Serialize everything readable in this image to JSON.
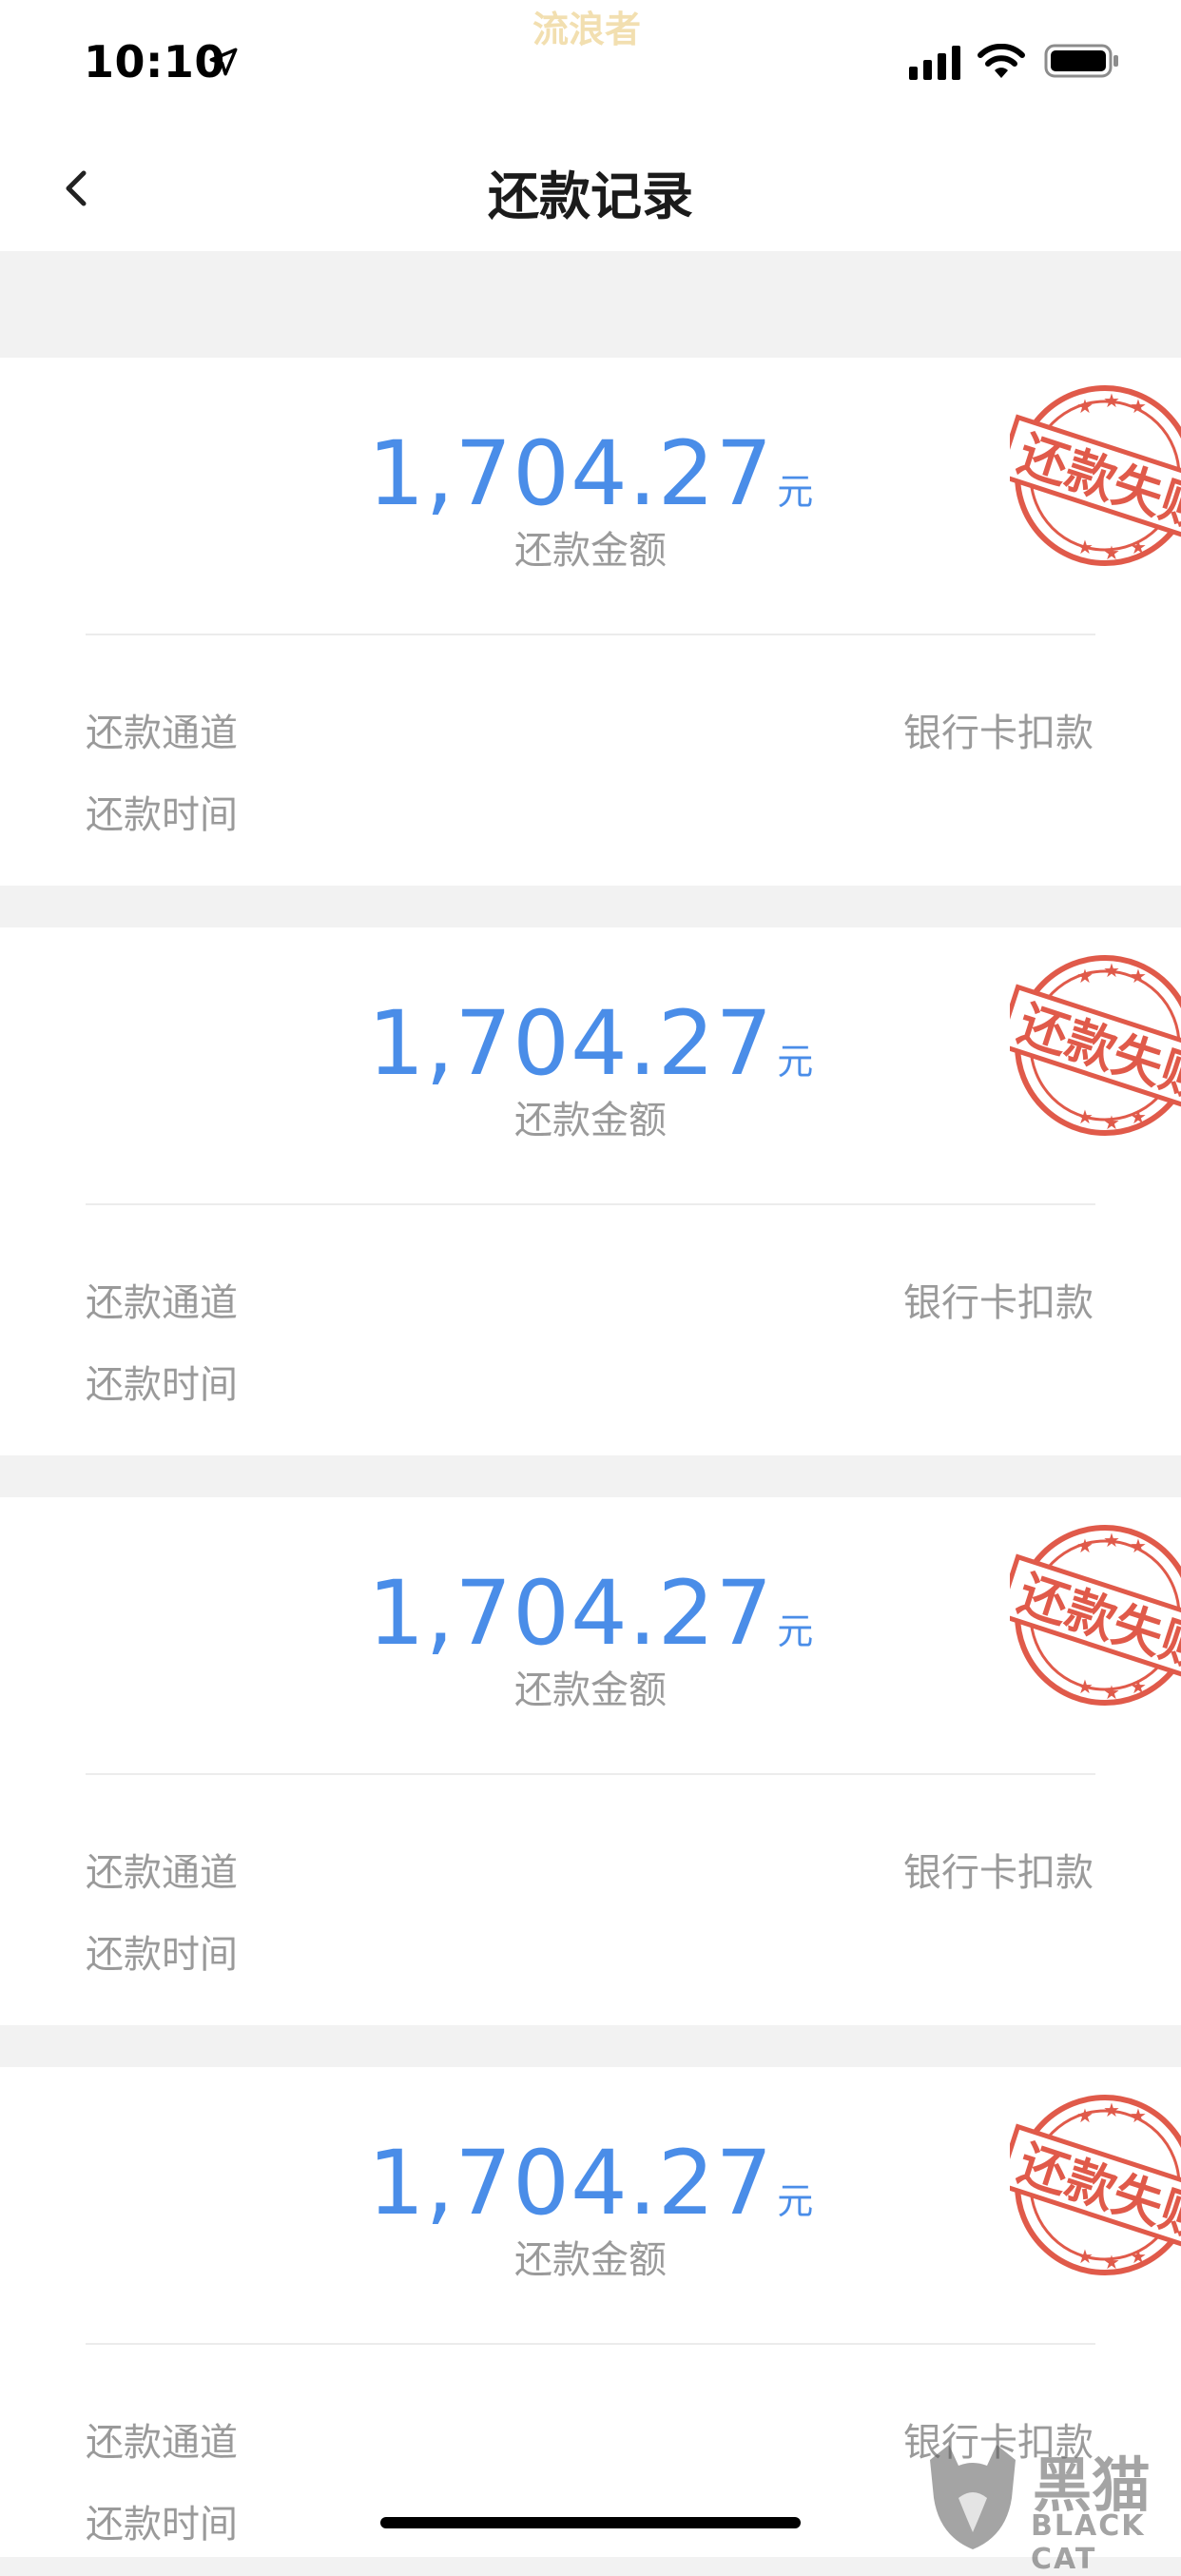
{
  "status_bar": {
    "time": "10:10",
    "watermark": "流浪者",
    "icons": [
      "location-arrow-icon",
      "cellular-signal-icon",
      "wifi-icon",
      "battery-icon"
    ]
  },
  "nav": {
    "title": "还款记录",
    "back_icon": "chevron-left-icon"
  },
  "records": [
    {
      "amount": "1,704.27",
      "unit": "元",
      "amount_label": "还款金额",
      "channel_label": "还款通道",
      "channel_value": "银行卡扣款",
      "time_label": "还款时间",
      "stamp_text": "还款失败"
    },
    {
      "amount": "1,704.27",
      "unit": "元",
      "amount_label": "还款金额",
      "channel_label": "还款通道",
      "channel_value": "银行卡扣款",
      "time_label": "还款时间",
      "stamp_text": "还款失败"
    },
    {
      "amount": "1,704.27",
      "unit": "元",
      "amount_label": "还款金额",
      "channel_label": "还款通道",
      "channel_value": "银行卡扣款",
      "time_label": "还款时间",
      "stamp_text": "还款失败"
    },
    {
      "amount": "1,704.27",
      "unit": "元",
      "amount_label": "还款金额",
      "channel_label": "还款通道",
      "channel_value": "银行卡扣款",
      "time_label": "还款时间",
      "stamp_text": "还款失败"
    }
  ],
  "watermark_logo": {
    "text_cn": "黑猫",
    "text_en": "BLACK CAT"
  },
  "colors": {
    "amount": "#4a8de8",
    "stamp": "#e05a4a",
    "label": "#9a9a9a",
    "background": "#f2f2f2"
  }
}
